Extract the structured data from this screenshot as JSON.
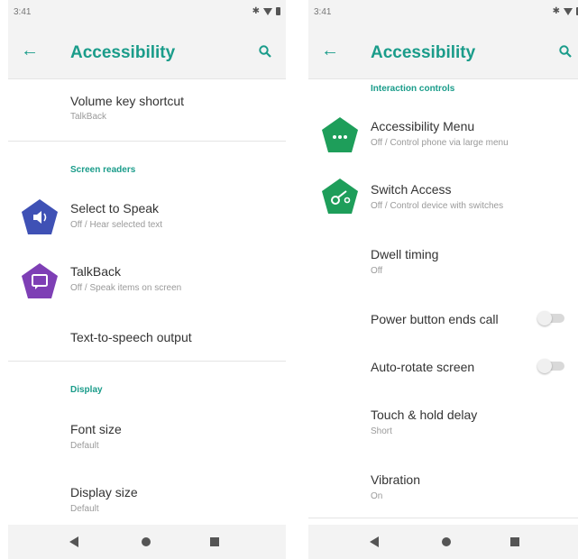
{
  "left": {
    "status_time": "3:41",
    "title": "Accessibility",
    "items": [
      {
        "title": "Volume key shortcut",
        "subtitle": "TalkBack"
      },
      {
        "category": "Screen readers"
      },
      {
        "title": "Select to Speak",
        "subtitle": "Off / Hear selected text",
        "icon": "volume-icon",
        "color": "#3f51b5"
      },
      {
        "title": "TalkBack",
        "subtitle": "Off / Speak items on screen",
        "icon": "chat-icon",
        "color": "#7e3fb5"
      },
      {
        "title": "Text-to-speech output"
      },
      {
        "category": "Display"
      },
      {
        "title": "Font size",
        "subtitle": "Default"
      },
      {
        "title": "Display size",
        "subtitle": "Default"
      }
    ]
  },
  "right": {
    "status_time": "3:41",
    "title": "Accessibility",
    "items": [
      {
        "category": "Interaction controls"
      },
      {
        "title": "Accessibility Menu",
        "subtitle": "Off / Control phone via large menu",
        "icon": "menu-dots-icon",
        "color": "#1e9e5a"
      },
      {
        "title": "Switch Access",
        "subtitle": "Off / Control device with switches",
        "icon": "switch-icon",
        "color": "#1e9e5a"
      },
      {
        "title": "Dwell timing",
        "subtitle": "Off"
      },
      {
        "title": "Power button ends call",
        "toggle": false
      },
      {
        "title": "Auto-rotate screen",
        "toggle": false
      },
      {
        "title": "Touch & hold delay",
        "subtitle": "Short"
      },
      {
        "title": "Vibration",
        "subtitle": "On"
      }
    ]
  },
  "colors": {
    "accent": "#1a9c8a",
    "bar": "#f3f3f3"
  }
}
